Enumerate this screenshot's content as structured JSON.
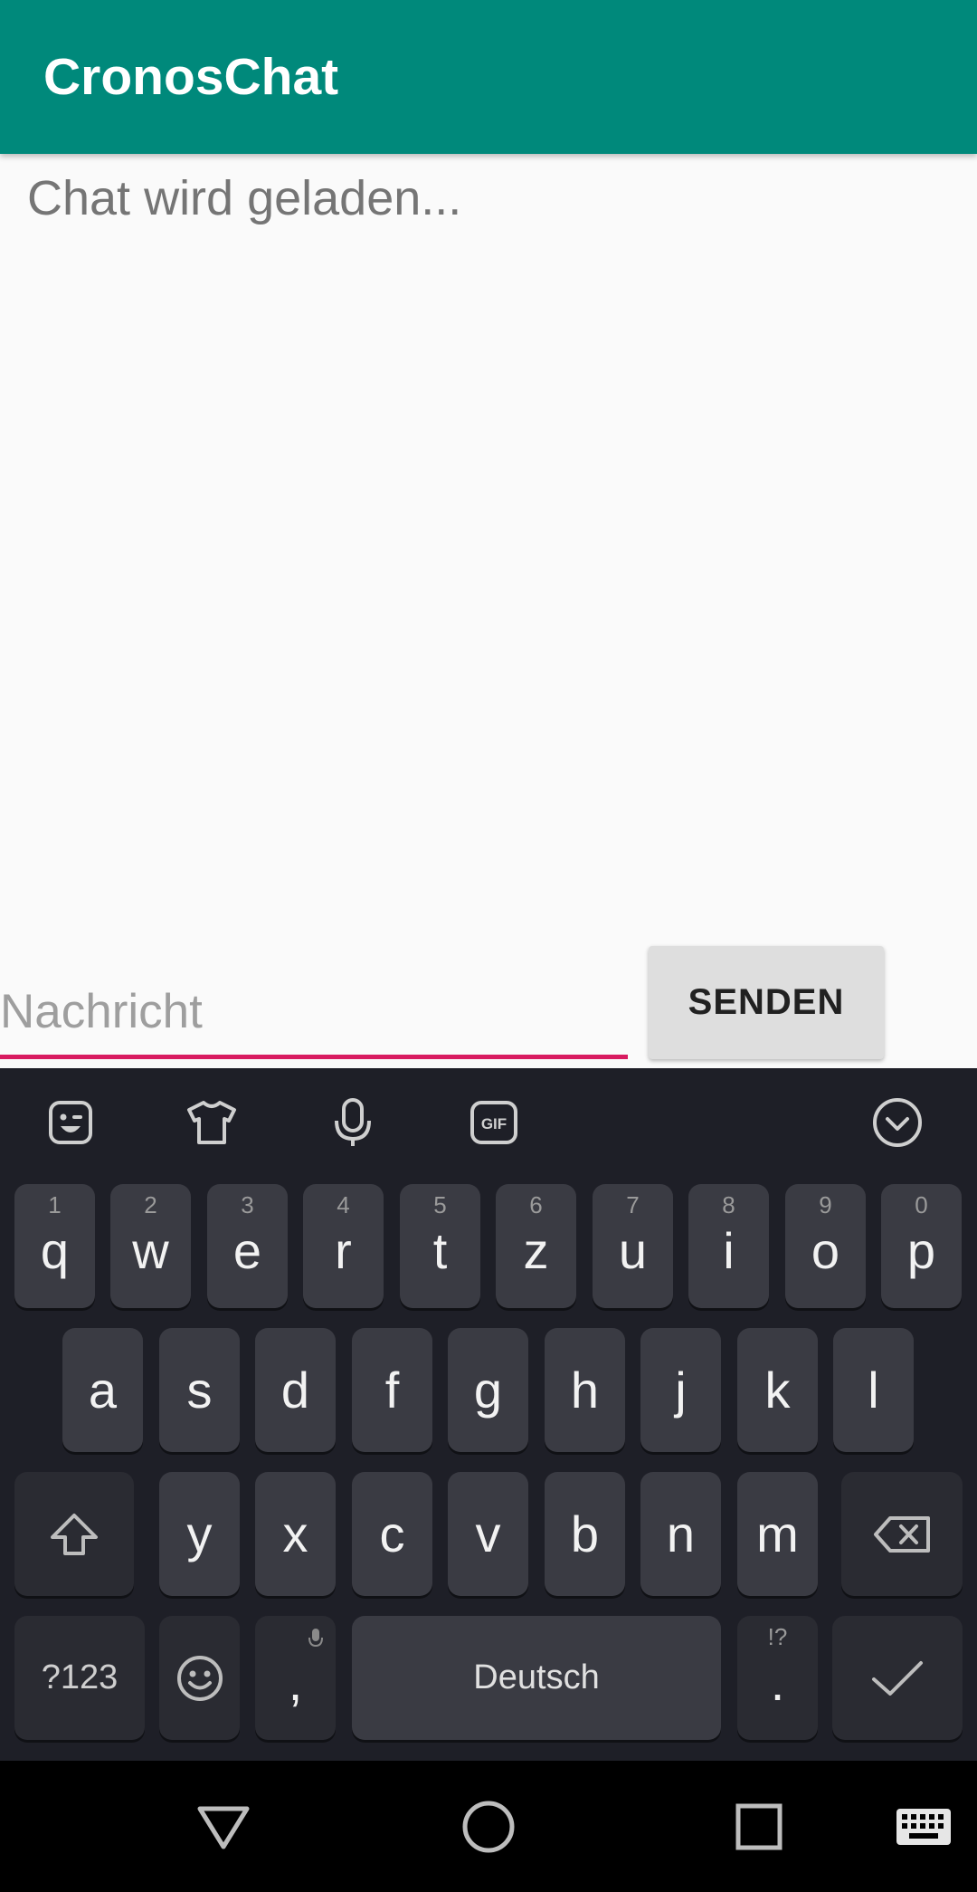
{
  "app": {
    "title": "CronosChat"
  },
  "chat": {
    "loading_text": "Chat wird geladen..."
  },
  "composer": {
    "placeholder": "Nachricht",
    "value": "",
    "send_label": "SENDEN"
  },
  "keyboard": {
    "toolbar": [
      "sticker-icon",
      "theme-icon",
      "microphone-icon",
      "gif-icon",
      "collapse-keyboard-icon"
    ],
    "row1": [
      {
        "label": "q",
        "hint": "1"
      },
      {
        "label": "w",
        "hint": "2"
      },
      {
        "label": "e",
        "hint": "3"
      },
      {
        "label": "r",
        "hint": "4"
      },
      {
        "label": "t",
        "hint": "5"
      },
      {
        "label": "z",
        "hint": "6"
      },
      {
        "label": "u",
        "hint": "7"
      },
      {
        "label": "i",
        "hint": "8"
      },
      {
        "label": "o",
        "hint": "9"
      },
      {
        "label": "p",
        "hint": "0"
      }
    ],
    "row2": [
      "a",
      "s",
      "d",
      "f",
      "g",
      "h",
      "j",
      "k",
      "l"
    ],
    "row3": [
      "y",
      "x",
      "c",
      "v",
      "b",
      "n",
      "m"
    ],
    "symbols_label": "?123",
    "comma_label": ",",
    "space_label": "Deutsch",
    "period_label": ".",
    "period_hint": "!?",
    "accent": "#d81b60",
    "app_bar_color": "#00897b"
  },
  "navigation": [
    "back-icon",
    "home-icon",
    "recents-icon",
    "keyboard-switch-icon"
  ]
}
